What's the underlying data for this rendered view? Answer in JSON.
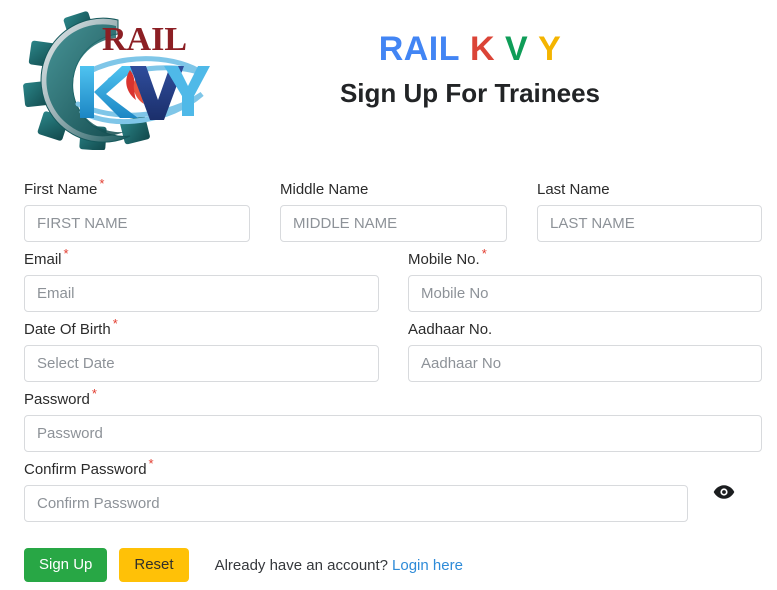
{
  "header": {
    "logo": {
      "alt": "RAIL KVY logo",
      "gear_color": "#1f6b6e",
      "rail_text": "RAIL",
      "rail_color": "#8c1f24",
      "kvy_text": "KVY",
      "kvy_color": "#2aa8e0",
      "flame_color": "#d9332e",
      "swoosh_color": "#7fc6e8"
    },
    "brand": {
      "part1": "RAIL",
      "part2": "K",
      "part3": "V",
      "part4": "Y",
      "color1": "#4285F4",
      "color2": "#DB4437",
      "color3": "#0F9D58",
      "color4": "#F4B400"
    },
    "subtitle": "Sign Up For Trainees"
  },
  "form": {
    "first_name": {
      "label": "First Name",
      "required": "*",
      "placeholder": "FIRST NAME",
      "value": ""
    },
    "middle_name": {
      "label": "Middle Name",
      "required": "",
      "placeholder": "MIDDLE NAME",
      "value": ""
    },
    "last_name": {
      "label": "Last Name",
      "required": "",
      "placeholder": "LAST NAME",
      "value": ""
    },
    "email": {
      "label": "Email",
      "required": "*",
      "placeholder": "Email",
      "value": ""
    },
    "mobile": {
      "label": "Mobile No.",
      "required": "*",
      "placeholder": "Mobile No",
      "value": ""
    },
    "dob": {
      "label": "Date Of Birth",
      "required": "*",
      "placeholder": "Select Date",
      "value": ""
    },
    "aadhaar": {
      "label": "Aadhaar No.",
      "required": "",
      "placeholder": "Aadhaar No",
      "value": ""
    },
    "password": {
      "label": "Password",
      "required": "*",
      "placeholder": "Password",
      "value": ""
    },
    "confirm_password": {
      "label": "Confirm Password",
      "required": "*",
      "placeholder": "Confirm Password",
      "value": "",
      "toggle_icon": "eye-icon"
    }
  },
  "footer": {
    "signup_label": "Sign Up",
    "reset_label": "Reset",
    "account_text": "Already have an account?",
    "login_link": "Login here",
    "signup_color": "#28a745",
    "reset_color": "#ffc107",
    "link_color": "#2e8bd8"
  }
}
